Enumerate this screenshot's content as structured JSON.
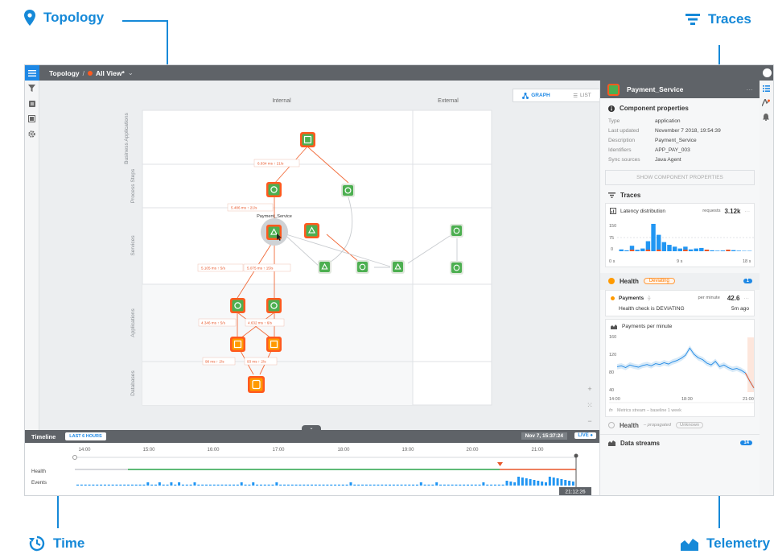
{
  "callouts": {
    "topology": "Topology",
    "traces": "Traces",
    "time": "Time",
    "telemetry": "Telemetry"
  },
  "header": {
    "breadcrumb_root": "Topology",
    "view_name": "All View*"
  },
  "view_toggle": {
    "graph": "GRAPH",
    "list": "LIST"
  },
  "lanes": {
    "columns": [
      "Internal",
      "External"
    ],
    "rows": [
      "Business Applications",
      "Process Steps",
      "Services",
      "Applications",
      "Databases"
    ]
  },
  "edges": {
    "e1": "6.834 ms ↑  21/s",
    "e2": "5.486 ms ↑  21/s",
    "e3": "5.105 ms ↑  5/s",
    "e4": "5.075 ms ↑  15/s",
    "e5": "4.346 ms ↑  5/s",
    "e6": "4.632 ms ↑  6/s",
    "e7": "98 ms ↑  2/s",
    "e8": "93 ms ↑  2/s"
  },
  "selected_node_label": "Payment_Service",
  "timeline": {
    "title": "Timeline",
    "range": "LAST 6 HOURS",
    "date": "Nov 7, 15:37:24",
    "live": "LIVE",
    "ticks": [
      "14:00",
      "15:00",
      "16:00",
      "17:00",
      "18:00",
      "19:00",
      "20:00",
      "21:00"
    ],
    "rows": [
      "Health",
      "Events"
    ],
    "cursor_time": "21:12:26"
  },
  "panel": {
    "title": "Payment_Service",
    "props_title": "Component properties",
    "props": [
      {
        "k": "Type",
        "v": "application"
      },
      {
        "k": "Last updated",
        "v": "November 7 2018, 19:54:39"
      },
      {
        "k": "Description",
        "v": "Payment_Service"
      },
      {
        "k": "Identifiers",
        "v": "APP_PAY_003"
      },
      {
        "k": "Sync sources",
        "v": "Java Agent"
      }
    ],
    "show_props": "SHOW COMPONENT PROPERTIES",
    "traces_title": "Traces",
    "latency": {
      "title": "Latency distribution",
      "unit": "requests",
      "value": "3.12k",
      "y_ticks": [
        "150",
        "75",
        "0"
      ],
      "x_ticks": [
        "0 s",
        "9 s",
        "18 s"
      ]
    },
    "health": {
      "title": "Health",
      "status": "Deviating",
      "count": "1"
    },
    "payments": {
      "title": "Payments",
      "unit": "per minute",
      "value": "42.6",
      "check": "Health check is DEVIATING",
      "ago": "5m ago"
    },
    "ppm": {
      "title": "Payments per minute",
      "y_ticks": [
        "160",
        "120",
        "80",
        "40"
      ],
      "x_ticks": [
        "14:00",
        "18:30",
        "21:00"
      ],
      "footer": "Metrics stream – baseline 1 week"
    },
    "health2": {
      "title": "Health",
      "sub": "– propagated",
      "status": "Unknown"
    },
    "streams": {
      "title": "Data streams",
      "count": "14"
    }
  },
  "colors": {
    "accent": "#1689d8",
    "alert": "#ff5a1f",
    "ok": "#4caf50",
    "warn": "#ff9a00"
  },
  "chart_data": [
    {
      "type": "bar",
      "title": "Latency distribution",
      "ylim": [
        0,
        150
      ],
      "x_range": [
        0,
        18
      ],
      "values": [
        10,
        5,
        30,
        8,
        15,
        55,
        150,
        90,
        50,
        35,
        25,
        15,
        25,
        10,
        15,
        18,
        8,
        5,
        3,
        4,
        2,
        6,
        3,
        2,
        2
      ]
    },
    {
      "type": "line",
      "title": "Payments per minute",
      "ylim": [
        40,
        160
      ],
      "series": [
        {
          "values": [
            92,
            94,
            90,
            96,
            93,
            91,
            95,
            97,
            94,
            99,
            97,
            101,
            98,
            103,
            106,
            111,
            118,
            134,
            120,
            112,
            108,
            100,
            96,
            104,
            92,
            96,
            90,
            86,
            88,
            84,
            78,
            60,
            44
          ]
        }
      ]
    }
  ]
}
